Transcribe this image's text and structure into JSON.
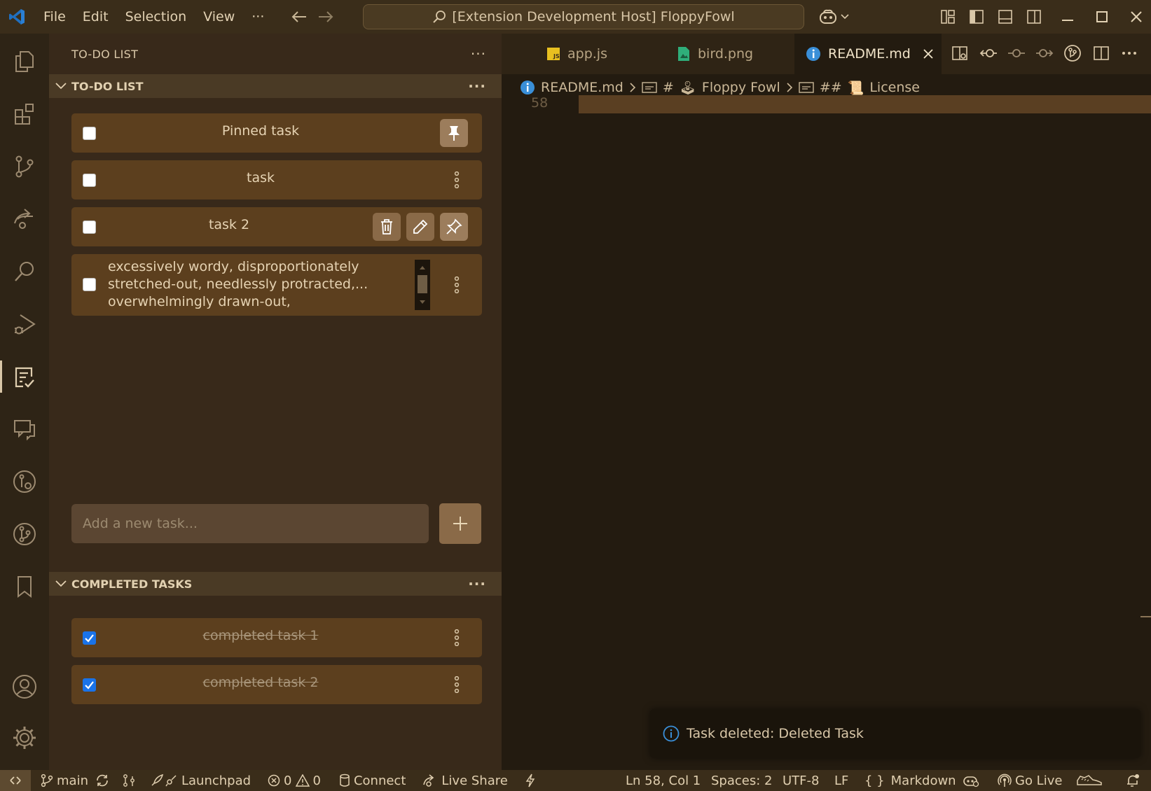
{
  "window": {
    "menu": [
      "File",
      "Edit",
      "Selection",
      "View",
      "···"
    ],
    "command_center": "[Extension Development Host] FloppyFowl"
  },
  "activity_bar": {
    "icons": [
      "explorer-icon",
      "extensions-icon",
      "source-control-icon",
      "remote-explorer-icon",
      "search-icon",
      "run-debug-icon",
      "todo-list-icon",
      "comments-icon",
      "gitlens-inspect-icon",
      "gitlens-icon",
      "bookmarks-icon",
      "account-icon",
      "settings-gear-icon"
    ],
    "active": "todo-list-icon"
  },
  "sidebar": {
    "title": "TO-DO LIST",
    "menu": "···",
    "todo_section": {
      "title": "TO-DO LIST",
      "menu": "···",
      "tasks": [
        {
          "label": "Pinned task",
          "checked": false,
          "pinned": true
        },
        {
          "label": "task",
          "checked": false
        },
        {
          "label": "task 2",
          "checked": false,
          "hovered": true
        },
        {
          "label": "excessively wordy, disproportionately stretched-out, needlessly protracted,... overwhelmingly drawn-out, extraordinarily",
          "checked": false
        }
      ]
    },
    "new_task_placeholder": "Add a new task...",
    "add_button": "+",
    "completed_section": {
      "title": "COMPLETED TASKS",
      "menu": "···",
      "tasks": [
        {
          "label": "completed task 1",
          "checked": true
        },
        {
          "label": "completed task 2",
          "checked": true
        }
      ]
    }
  },
  "editor": {
    "tabs": [
      {
        "label": "app.js",
        "icon": "js-file-icon",
        "active": false
      },
      {
        "label": "bird.png",
        "icon": "image-file-icon",
        "active": false
      },
      {
        "label": "README.md",
        "icon": "info-icon",
        "active": true
      }
    ],
    "breadcrumbs": {
      "file": "README.md",
      "h1_hash": "#",
      "h1_emoji": "🕹",
      "h1": "Floppy Fowl",
      "h2_hash": "##",
      "h2_emoji": "📜",
      "h2": "License"
    },
    "line_number": "58",
    "notification": "Task deleted: Deleted Task"
  },
  "statusbar": {
    "branch": "main",
    "launchpad": "Launchpad",
    "errors": "0",
    "warnings": "0",
    "connect": "Connect",
    "live_share": "Live Share",
    "position": "Ln 58, Col 1",
    "spaces": "Spaces: 2",
    "encoding": "UTF-8",
    "eol": "LF",
    "language": "Markdown",
    "go_live": "Go Live"
  },
  "colors": {
    "accent_check": "#1a73e8",
    "task_bg": "#5c3f1e",
    "sidebar_bg": "#38291a",
    "editor_bg": "#231b10"
  }
}
